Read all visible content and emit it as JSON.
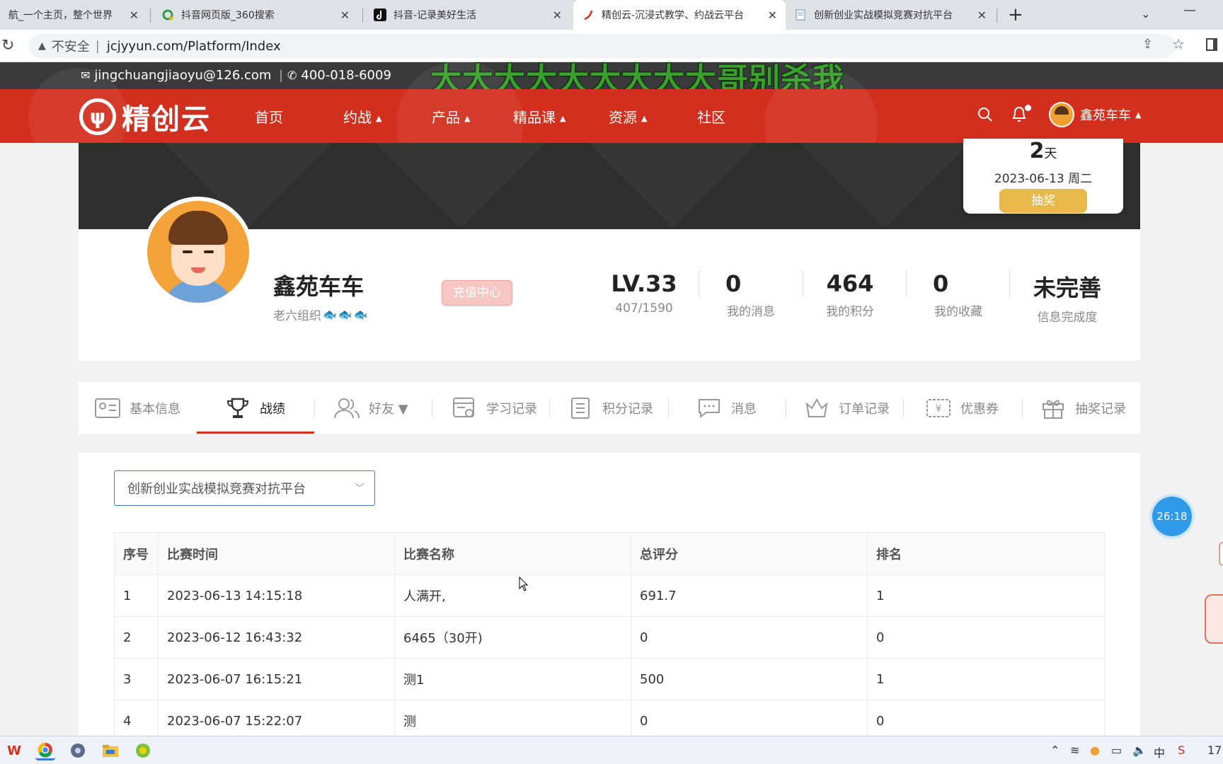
{
  "browser": {
    "tabs": [
      {
        "title": "航_一个主页，整个世界",
        "active": false
      },
      {
        "title": "抖音网页版_360搜索",
        "active": false
      },
      {
        "title": "抖音-记录美好生活",
        "active": false
      },
      {
        "title": "精创云-沉浸式教学、约战云平台",
        "active": true
      },
      {
        "title": "创新创业实战模拟竞赛对抗平台",
        "active": false
      }
    ],
    "new_tab": "+",
    "close": "✕",
    "address": {
      "warning": "▲",
      "insecure": "不安全",
      "separator": "|",
      "url": "jcjyyun.com/Platform/Index"
    }
  },
  "overlay_text": "大大大大大大大大大哥别杀我",
  "topbar": {
    "email": "jingchuangjiaoyu@126.com",
    "phone": "400-018-6009",
    "separator": "|"
  },
  "nav": {
    "logo": "精创云",
    "items": [
      {
        "label": "首页",
        "caret": false
      },
      {
        "label": "约战",
        "caret": true
      },
      {
        "label": "产品",
        "caret": true
      },
      {
        "label": "精品课",
        "caret": true
      },
      {
        "label": "资源",
        "caret": true
      },
      {
        "label": "社区",
        "caret": false
      }
    ],
    "user": "鑫苑车车",
    "caret": "▲"
  },
  "calendar": {
    "days": "2",
    "days_unit": "天",
    "date": "2023-06-13 周二",
    "draw_button": "抽奖"
  },
  "profile": {
    "name": "鑫苑车车",
    "group": "老六组织",
    "recharge": "充值中心",
    "stats": [
      {
        "value": "LV.33",
        "label": "407/1590"
      },
      {
        "value": "0",
        "label": "我的消息"
      },
      {
        "value": "464",
        "label": "我的积分"
      },
      {
        "value": "0",
        "label": "我的收藏"
      },
      {
        "value": "未完善",
        "label": "信息完成度"
      }
    ]
  },
  "profile_tabs": [
    {
      "label": "基本信息",
      "icon": "id-card-icon"
    },
    {
      "label": "战绩",
      "icon": "trophy-icon",
      "active": true
    },
    {
      "label": "好友 ▼",
      "icon": "friends-icon"
    },
    {
      "label": "学习记录",
      "icon": "study-record-icon"
    },
    {
      "label": "积分记录",
      "icon": "points-record-icon"
    },
    {
      "label": "消息",
      "icon": "message-icon"
    },
    {
      "label": "订单记录",
      "icon": "order-icon"
    },
    {
      "label": "优惠券",
      "icon": "coupon-icon"
    },
    {
      "label": "抽奖记录",
      "icon": "gift-icon"
    }
  ],
  "platform_select": {
    "value": "创新创业实战模拟竞赛对抗平台"
  },
  "table": {
    "headers": [
      "序号",
      "比赛时间",
      "比赛名称",
      "总评分",
      "排名"
    ],
    "rows": [
      [
        "1",
        "2023-06-13 14:15:18",
        "人满开,",
        "691.7",
        "1"
      ],
      [
        "2",
        "2023-06-12 16:43:32",
        "6465（30开)",
        "0",
        "0"
      ],
      [
        "3",
        "2023-06-07 16:15:21",
        "测1",
        "500",
        "1"
      ],
      [
        "4",
        "2023-06-07 15:22:07",
        "测",
        "0",
        "0"
      ]
    ]
  },
  "timer": "26:18",
  "taskbar": {
    "clock": "17"
  },
  "colors": {
    "brand_red": "#d32f1e",
    "accent_blue": "#3a7bd5",
    "gold": "#e8b94a"
  }
}
